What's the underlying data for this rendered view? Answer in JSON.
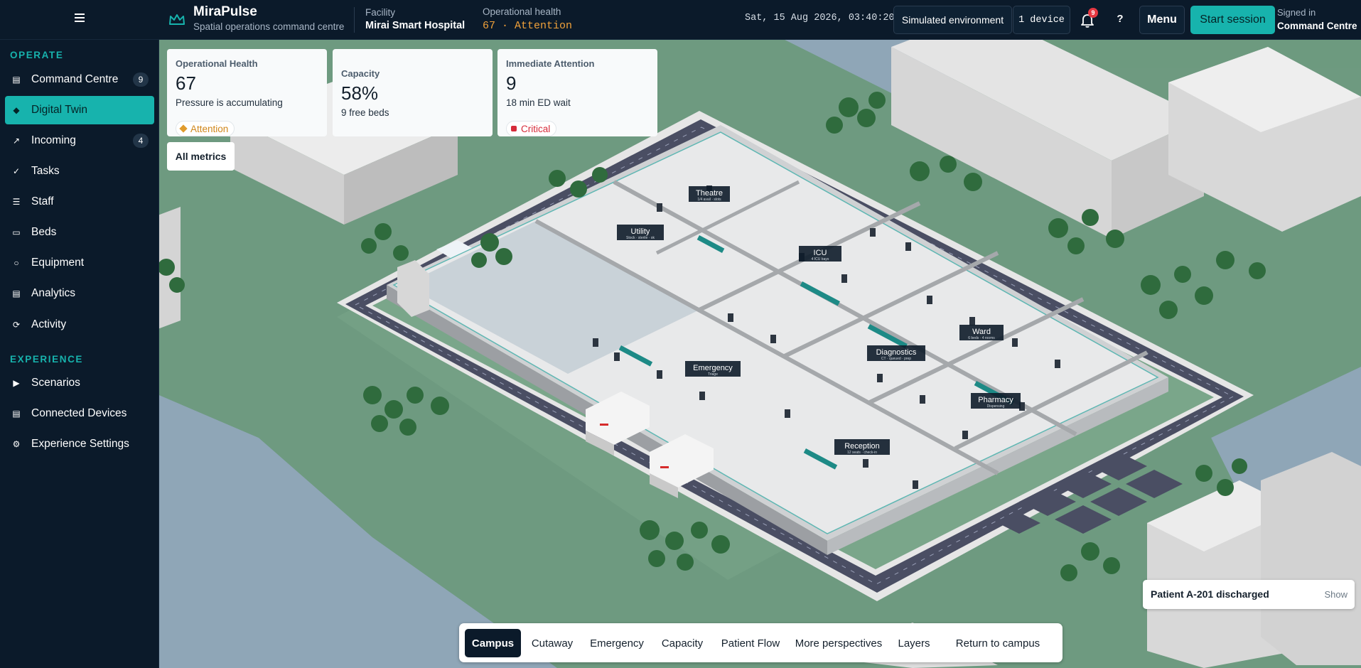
{
  "header": {
    "brand_title": "MiraPulse",
    "brand_subtitle": "Spatial operations command centre",
    "facility_label": "Facility",
    "facility_value": "Mirai Smart Hospital",
    "health_label": "Operational health",
    "health_value": "67 · Attention",
    "datetime": "Sat, 15 Aug 2026, 03:40:20",
    "environment_button": "Simulated environment",
    "devices_button": "1 device",
    "notifications_count": "9",
    "help_label": "?",
    "menu_button": "Menu",
    "start_session_button": "Start session",
    "signed_in_label": "Signed in",
    "signed_in_value": "Command Centre",
    "accent_color": "#17b3ad",
    "attention_color": "#f0a13a"
  },
  "sidebar": {
    "section_operate": "OPERATE",
    "section_experience": "EXPERIENCE",
    "items": [
      {
        "label": "Command Centre",
        "badge": "9",
        "icon": "grid-icon"
      },
      {
        "label": "Digital Twin",
        "badge": "",
        "icon": "cube-icon",
        "active": true
      },
      {
        "label": "Incoming",
        "badge": "4",
        "icon": "arrow-icon"
      },
      {
        "label": "Tasks",
        "badge": "",
        "icon": "check-icon"
      },
      {
        "label": "Staff",
        "badge": "",
        "icon": "list-icon"
      },
      {
        "label": "Beds",
        "badge": "",
        "icon": "bed-icon"
      },
      {
        "label": "Equipment",
        "badge": "",
        "icon": "circle-icon"
      },
      {
        "label": "Analytics",
        "badge": "",
        "icon": "chart-icon"
      },
      {
        "label": "Activity",
        "badge": "",
        "icon": "refresh-icon"
      }
    ],
    "experience_items": [
      {
        "label": "Scenarios",
        "icon": "play-icon"
      },
      {
        "label": "Connected Devices",
        "icon": "device-icon"
      },
      {
        "label": "Experience Settings",
        "icon": "gear-icon"
      }
    ]
  },
  "metrics": {
    "health": {
      "title": "Operational Health",
      "value": "67",
      "sub": "Pressure is accumulating",
      "chip": "Attention"
    },
    "capacity": {
      "title": "Capacity",
      "value": "58%",
      "sub": "9 free beds"
    },
    "attention": {
      "title": "Immediate Attention",
      "value": "9",
      "sub": "18 min ED wait",
      "chip": "Critical"
    },
    "all_metrics_button": "All metrics"
  },
  "rooms": {
    "theatre": {
      "name": "Theatre",
      "sub": "1/4 avail · slots"
    },
    "utility": {
      "name": "Utility",
      "sub": "Stock · sterile · ok"
    },
    "icu": {
      "name": "ICU",
      "sub": "4 ICU bays"
    },
    "ward": {
      "name": "Ward",
      "sub": "6 beds · 4 rooms"
    },
    "diagnostics": {
      "name": "Diagnostics",
      "sub": "CT · queued · prep"
    },
    "emergency": {
      "name": "Emergency",
      "sub": "Triage"
    },
    "pharmacy": {
      "name": "Pharmacy",
      "sub": "Dispensing"
    },
    "reception": {
      "name": "Reception",
      "sub": "12 seats · check-in"
    }
  },
  "toast": {
    "text": "Patient A-201 discharged",
    "action": "Show"
  },
  "views": {
    "campus": "Campus",
    "cutaway": "Cutaway",
    "emergency": "Emergency",
    "capacity": "Capacity",
    "patient_flow": "Patient Flow",
    "more": "More perspectives",
    "layers": "Layers",
    "return": "Return to campus"
  }
}
